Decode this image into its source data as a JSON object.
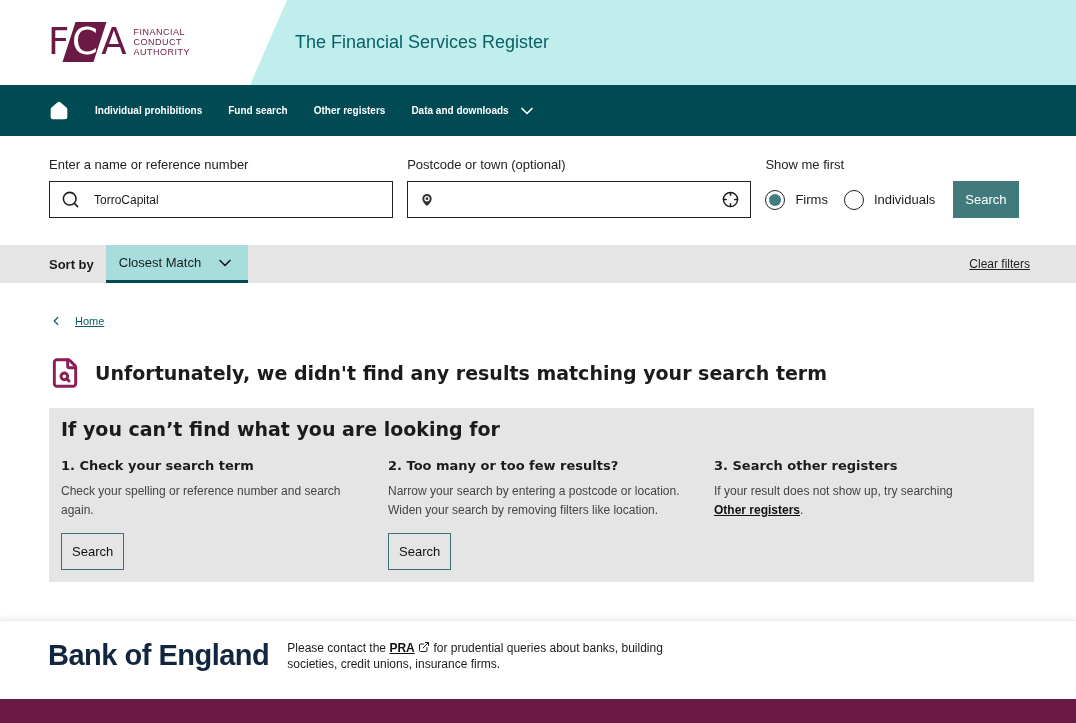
{
  "header": {
    "logo": {
      "letters": "FCA",
      "lines": [
        "FINANCIAL",
        "CONDUCT",
        "AUTHORITY"
      ]
    },
    "title": "The Financial Services Register"
  },
  "nav": {
    "items": [
      {
        "label": "Individual prohibitions",
        "kind": "link"
      },
      {
        "label": "Fund search",
        "kind": "link"
      },
      {
        "label": "Other registers",
        "kind": "link"
      },
      {
        "label": "Data and downloads",
        "kind": "dropdown"
      }
    ]
  },
  "search": {
    "name_label": "Enter a name or reference number",
    "name_value": "TorroCapital",
    "location_label": "Postcode or town (optional)",
    "show_label": "Show me first",
    "options": [
      {
        "label": "Firms",
        "selected": true
      },
      {
        "label": "Individuals",
        "selected": false
      }
    ],
    "button": "Search"
  },
  "sort": {
    "label": "Sort by",
    "value": "Closest Match",
    "clear": "Clear filters"
  },
  "breadcrumb": {
    "label": "Home"
  },
  "message": "Unfortunately, we didn't find any results matching your search term",
  "help": {
    "title": "If you can’t find what you are looking for",
    "columns": [
      {
        "heading": "1. Check your search term",
        "text": "Check your spelling or reference number and search again.",
        "button": "Search"
      },
      {
        "heading": "2. Too many or too few results?",
        "text": "Narrow your search by entering a postcode or location. Widen your search by removing filters like location.",
        "button": "Search"
      },
      {
        "heading": "3. Search other registers",
        "text": "If your result does not show up, try searching ",
        "link": "Other registers",
        "after": "."
      }
    ]
  },
  "footer": {
    "brand": "Bank of England",
    "before": "Please contact the ",
    "link": "PRA",
    "after": " for prudential queries about banks, building societies, credit unions, insurance firms."
  }
}
